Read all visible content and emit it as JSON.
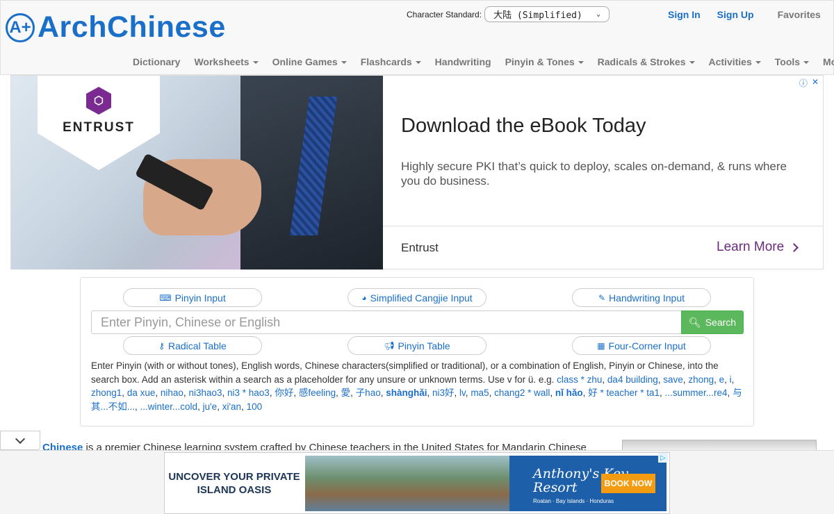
{
  "header": {
    "logo_badge": "A+",
    "logo_text": "ArchChinese",
    "standard_label": "Character Standard:",
    "standard_value": "大陆 (Simplified)",
    "sign_in": "Sign In",
    "sign_up": "Sign Up",
    "favorites": "Favorites"
  },
  "nav": {
    "items": [
      {
        "label": "Dictionary",
        "dropdown": false
      },
      {
        "label": "Worksheets",
        "dropdown": true
      },
      {
        "label": "Online Games",
        "dropdown": true
      },
      {
        "label": "Flashcards",
        "dropdown": true
      },
      {
        "label": "Handwriting",
        "dropdown": false
      },
      {
        "label": "Pinyin & Tones",
        "dropdown": true
      },
      {
        "label": "Radicals & Strokes",
        "dropdown": true
      },
      {
        "label": "Activities",
        "dropdown": true
      },
      {
        "label": "Tools",
        "dropdown": true
      },
      {
        "label": "More",
        "dropdown": true
      }
    ]
  },
  "ad_banner": {
    "brand_logo": "ENTRUST",
    "title": "Download the eBook Today",
    "description": "Highly secure PKI that’s quick to deploy, scales on-demand, & runs where you do business.",
    "advertiser": "Entrust",
    "cta": "Learn More",
    "info_icon": "ⓘ",
    "close_icon": "✕"
  },
  "search_panel": {
    "pinyin_input": "Pinyin Input",
    "cangjie_input": "Simplified Cangjie Input",
    "handwriting_input": "Handwriting Input",
    "search_placeholder": "Enter Pinyin, Chinese or English",
    "search_button": "Search",
    "radical_table": "Radical Table",
    "pinyin_table": "Pinyin Table",
    "four_corner_input": "Four-Corner Input",
    "help_text": "Enter Pinyin (with or without tones), English words, Chinese characters(simplified or traditional), or a combination of English, Pinyin or Chinese, into the search box. Add an asterisk within a search as a placeholder for any unsure or unknown terms. Use v for ü. e.g.",
    "examples": [
      {
        "text": "class * zhu",
        "bold": false
      },
      {
        "text": "da4 building",
        "bold": false
      },
      {
        "text": "save",
        "bold": false
      },
      {
        "text": "zhong",
        "bold": false
      },
      {
        "text": "e",
        "bold": false
      },
      {
        "text": "i",
        "bold": false
      },
      {
        "text": "zhong1",
        "bold": false
      },
      {
        "text": "da xue",
        "bold": false
      },
      {
        "text": "nihao",
        "bold": false
      },
      {
        "text": "ni3hao3",
        "bold": false
      },
      {
        "text": "ni3 * hao3",
        "bold": false
      },
      {
        "text": "你好",
        "bold": false
      },
      {
        "text": "感feeling",
        "bold": false
      },
      {
        "text": "愛",
        "bold": false
      },
      {
        "text": "子hao",
        "bold": false
      },
      {
        "text": "shànghǎi",
        "bold": true
      },
      {
        "text": "ni3好",
        "bold": false
      },
      {
        "text": "lv",
        "bold": false
      },
      {
        "text": "ma5",
        "bold": false
      },
      {
        "text": "chang2 * wall",
        "bold": false
      },
      {
        "text": "nǐ hǎo",
        "bold": true
      },
      {
        "text": "好 * teacher * ta1",
        "bold": false
      },
      {
        "text": "...summer...re4",
        "bold": false
      },
      {
        "text": "与其...不如...",
        "bold": false
      },
      {
        "text": "...winter...cold",
        "bold": false
      },
      {
        "text": "ju'e",
        "bold": false
      },
      {
        "text": "xi'an",
        "bold": false
      },
      {
        "text": "100",
        "bold": false
      }
    ]
  },
  "intro": {
    "brand": "Chinese",
    "text": " is a premier Chinese learning system crafted by Chinese teachers in the United States for Mandarin Chinese"
  },
  "bottom_ad": {
    "headline_1": "UNCOVER YOUR PRIVATE",
    "headline_2": "ISLAND OASIS",
    "resort_name": "Anthony's Key Resort",
    "resort_sub": "Roatan · Bay Islands · Honduras",
    "cta": "BOOK NOW"
  },
  "colors": {
    "brand_blue": "#1a6fc9",
    "search_green": "#5cb85c",
    "entrust_purple": "#6b2a7b"
  }
}
